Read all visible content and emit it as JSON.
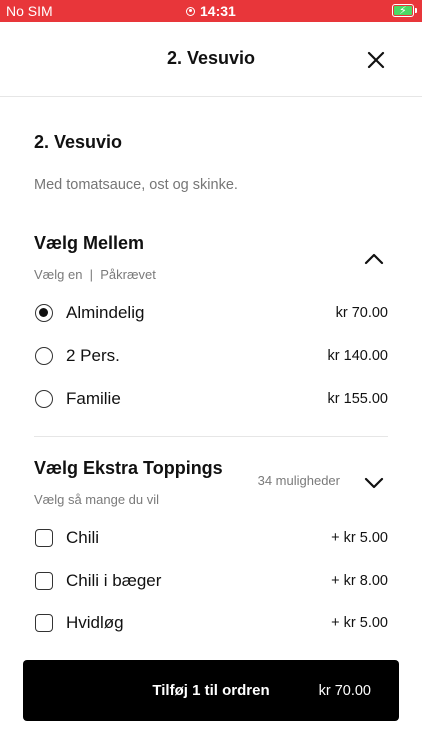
{
  "status_bar": {
    "carrier": "No SIM",
    "time": "14:31"
  },
  "header": {
    "title": "2. Vesuvio"
  },
  "item": {
    "title": "2. Vesuvio",
    "description": "Med tomatsauce, ost og skinke."
  },
  "size_section": {
    "title": "Vælg Mellem",
    "subtitle": "Vælg en  |  Påkrævet",
    "options": [
      {
        "label": "Almindelig",
        "price": "kr 70.00",
        "selected": true
      },
      {
        "label": "2 Pers.",
        "price": "kr 140.00",
        "selected": false
      },
      {
        "label": "Familie",
        "price": "kr 155.00",
        "selected": false
      }
    ]
  },
  "toppings_section": {
    "title": "Vælg Ekstra Toppings",
    "subtitle": "Vælg så mange du vil",
    "count": "34 muligheder",
    "options": [
      {
        "label": "Chili",
        "price": "+ kr 5.00",
        "checked": false
      },
      {
        "label": "Chili i bæger",
        "price": "+ kr 8.00",
        "checked": false
      },
      {
        "label": "Hvidløg",
        "price": "+ kr 5.00",
        "checked": false
      }
    ]
  },
  "cta": {
    "label": "Tilføj 1 til ordren",
    "price": "kr 70.00"
  },
  "colors": {
    "status_bar": "#e8363a",
    "cta_background": "#000000",
    "battery": "#4cd964"
  }
}
